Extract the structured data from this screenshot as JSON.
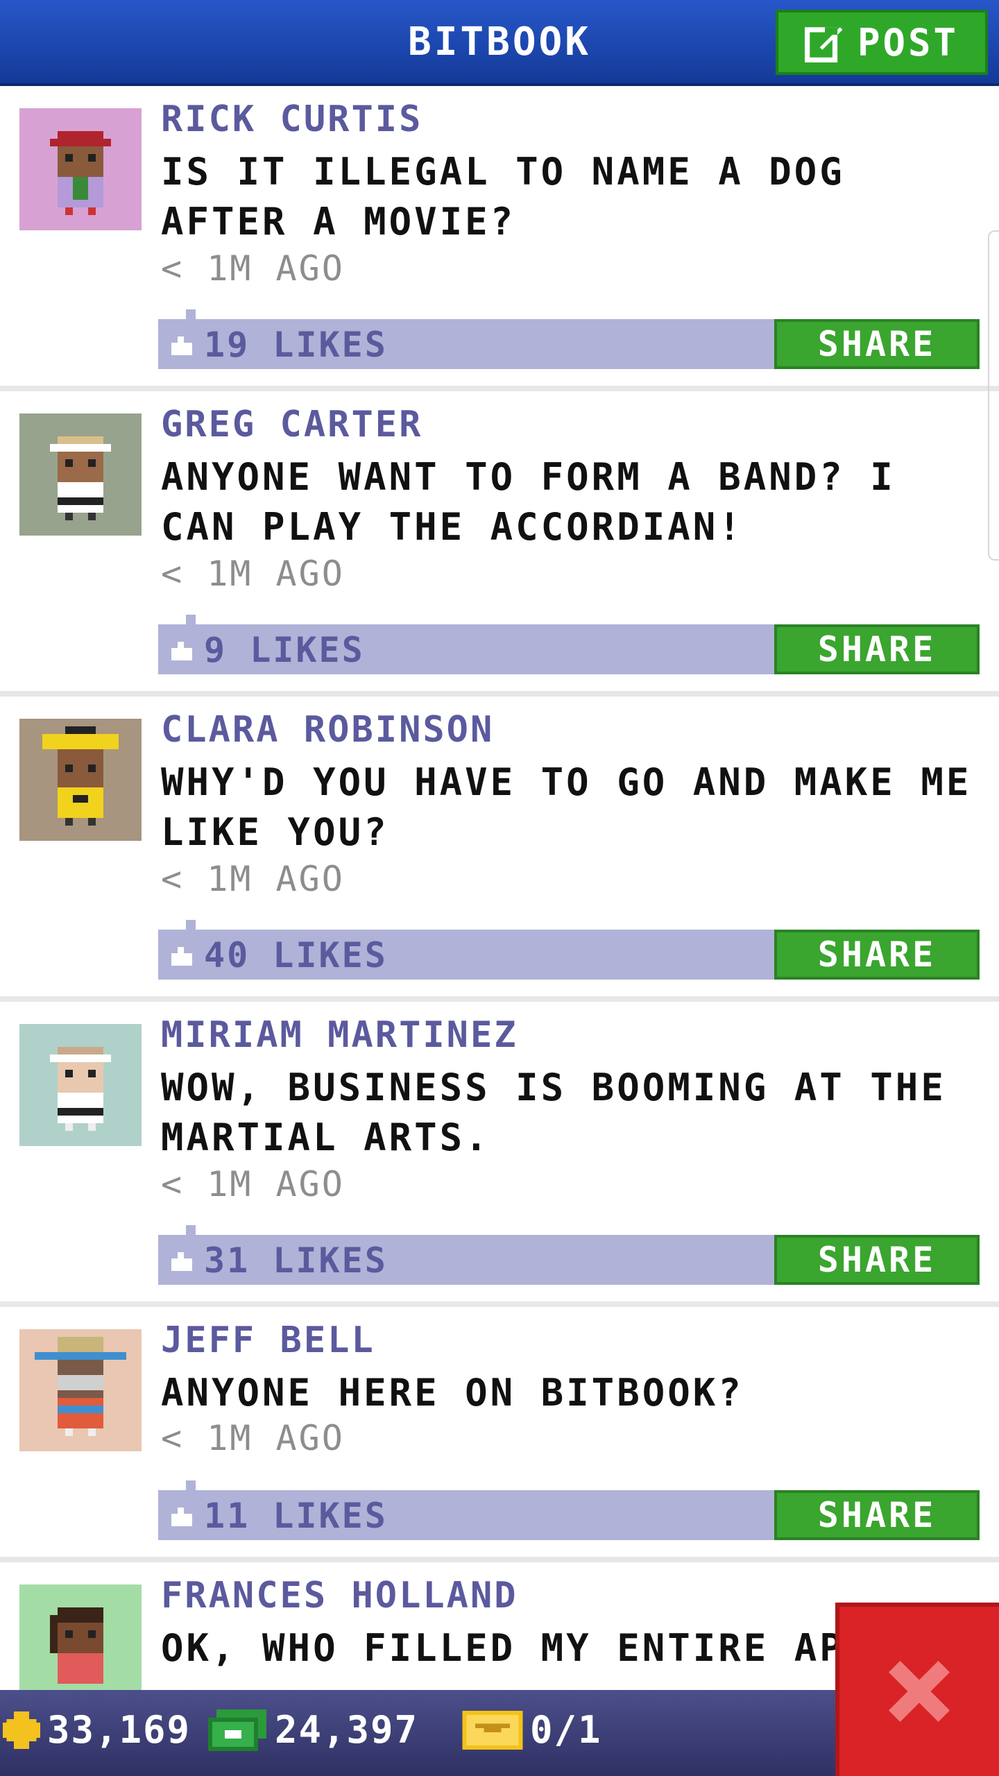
{
  "header": {
    "title": "BITBOOK",
    "post_label": "POST"
  },
  "posts": [
    {
      "author": "RICK CURTIS",
      "message": "IS IT ILLEGAL TO NAME A DOG AFTER A MOVIE?",
      "time": "< 1M AGO",
      "likes": "19 LIKES",
      "share_label": "SHARE",
      "avatar_bg": "#d7a2d3"
    },
    {
      "author": "GREG CARTER",
      "message": "ANYONE WANT TO FORM A BAND? I CAN PLAY THE ACCORDIAN!",
      "time": "< 1M AGO",
      "likes": "9 LIKES",
      "share_label": "SHARE",
      "avatar_bg": "#97a38c"
    },
    {
      "author": "CLARA ROBINSON",
      "message": "WHY'D YOU HAVE TO GO AND MAKE ME LIKE YOU?",
      "time": "< 1M AGO",
      "likes": "40 LIKES",
      "share_label": "SHARE",
      "avatar_bg": "#a79580"
    },
    {
      "author": "MIRIAM MARTINEZ",
      "message": "WOW, BUSINESS IS BOOMING AT THE MARTIAL ARTS.",
      "time": "< 1M AGO",
      "likes": "31 LIKES",
      "share_label": "SHARE",
      "avatar_bg": "#b0d1c9"
    },
    {
      "author": "JEFF BELL",
      "message": "ANYONE HERE ON BITBOOK?",
      "time": "< 1M AGO",
      "likes": "11 LIKES",
      "share_label": "SHARE",
      "avatar_bg": "#e9c7b2"
    },
    {
      "author": "FRANCES HOLLAND",
      "message": "OK, WHO FILLED MY ENTIRE APAR",
      "avatar_bg": "#a4dca6"
    }
  ],
  "status_bar": {
    "coins": "33,169",
    "bux": "24,397",
    "tickets": "0/1"
  },
  "icons": {
    "post": "edit-icon",
    "like": "thumb-up-icon",
    "coin": "coin-icon",
    "bux": "bux-icon",
    "ticket": "ticket-icon",
    "close": "close-icon"
  },
  "colors": {
    "header": "#1e4bb8",
    "accent_green": "#3aa52f",
    "likes_bar": "#b0b2d7",
    "author_text": "#5b5a9e",
    "close_red": "#d92326"
  }
}
